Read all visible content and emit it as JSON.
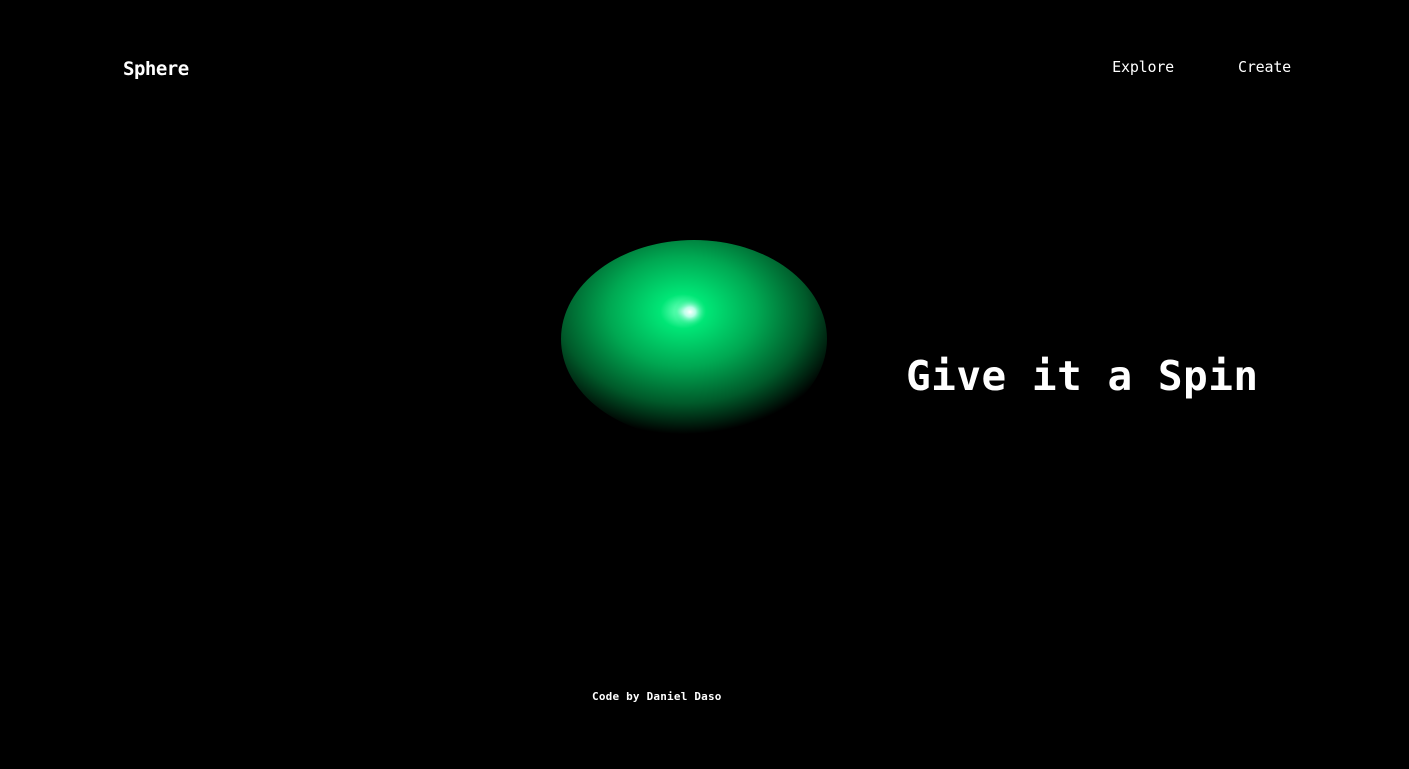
{
  "header": {
    "logo": "Sphere",
    "nav": [
      {
        "label": "Explore"
      },
      {
        "label": "Create"
      }
    ]
  },
  "hero": {
    "headline": "Give it a Spin"
  },
  "footer": {
    "credit": "Code by Daniel Daso"
  },
  "colors": {
    "background": "#000000",
    "sphere_accent": "#00e676",
    "text": "#ffffff"
  }
}
